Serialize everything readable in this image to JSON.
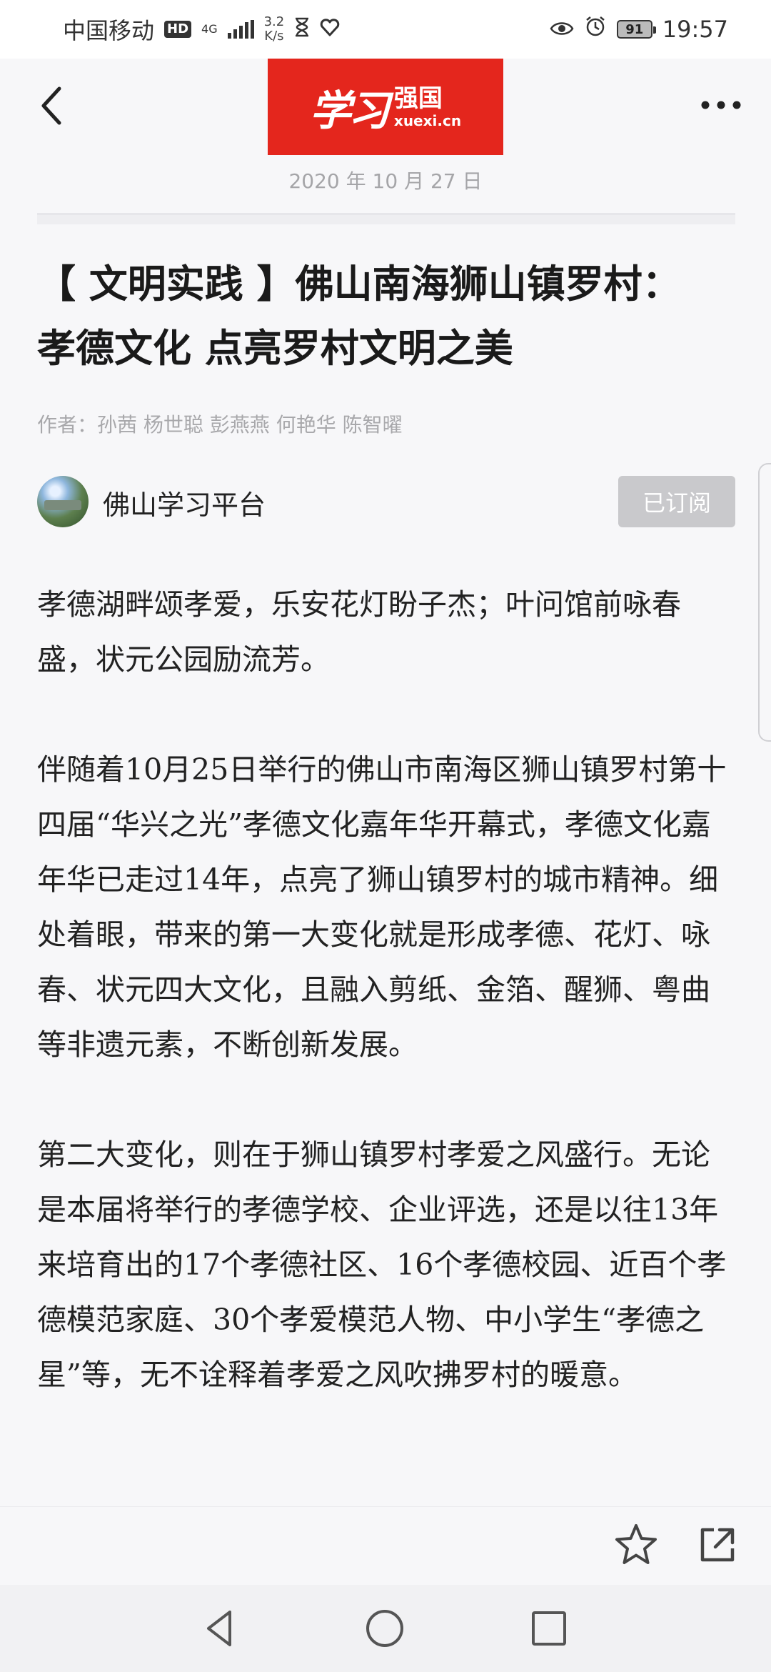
{
  "status_bar": {
    "carrier": "中国移动",
    "hd": "HD",
    "network": "4G",
    "speed_value": "3.2",
    "speed_unit": "K/s",
    "battery": "91",
    "time": "19:57"
  },
  "header": {
    "logo_main": "学习",
    "logo_sub": "强国",
    "logo_url": "xuexi.cn",
    "date": "2020 年 10 月 27 日"
  },
  "article": {
    "title": "【 文明实践 】佛山南海狮山镇罗村： 孝德文化 点亮罗村文明之美",
    "authors": "作者：孙茜 杨世聪 彭燕燕 何艳华 陈智曜",
    "publisher": "佛山学习平台",
    "subscribe_label": "已订阅",
    "paragraphs": [
      "孝德湖畔颂孝爱，乐安花灯盼子杰；叶问馆前咏春盛，状元公园励流芳。",
      "伴随着10月25日举行的佛山市南海区狮山镇罗村第十四届“华兴之光”孝德文化嘉年华开幕式，孝德文化嘉年华已走过14年，点亮了狮山镇罗村的城市精神。细处着眼，带来的第一大变化就是形成孝德、花灯、咏春、状元四大文化，且融入剪纸、金箔、醒狮、粤曲等非遗元素，不断创新发展。",
      "第二大变化，则在于狮山镇罗村孝爱之风盛行。无论是本届将举行的孝德学校、企业评选，还是以往13年来培育出的17个孝德社区、16个孝德校园、近百个孝德模范家庭、30个孝爱模范人物、中小学生“孝德之星”等，无不诠释着孝爱之风吹拂罗村的暖意。"
    ]
  },
  "icons": {
    "back": "back-arrow-icon",
    "more": "more-dots-icon",
    "favorite": "star-icon",
    "share": "share-icon",
    "nav_back": "triangle-back-icon",
    "nav_home": "circle-home-icon",
    "nav_recent": "square-recent-icon"
  },
  "colors": {
    "logo_red": "#e4261d",
    "subscribed_gray": "#c9c9cc",
    "meta_gray": "#a8a8ab"
  }
}
